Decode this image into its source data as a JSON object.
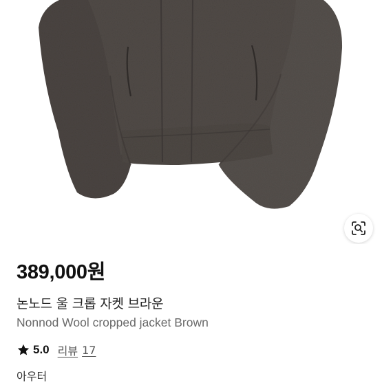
{
  "product": {
    "price": "389,000원",
    "title_ko": "논노드 울 크롭 자켓 브라운",
    "title_en": "Nonnod Wool cropped jacket Brown",
    "rating": "5.0",
    "reviews_label": "리뷰",
    "reviews_count": "17",
    "category": "아우터"
  },
  "icons": {
    "rating": "star-icon",
    "image_search": "lens-search-icon"
  },
  "colors": {
    "jacket": "#514b47",
    "text_primary": "#111111",
    "text_secondary": "#6a6a6a"
  }
}
